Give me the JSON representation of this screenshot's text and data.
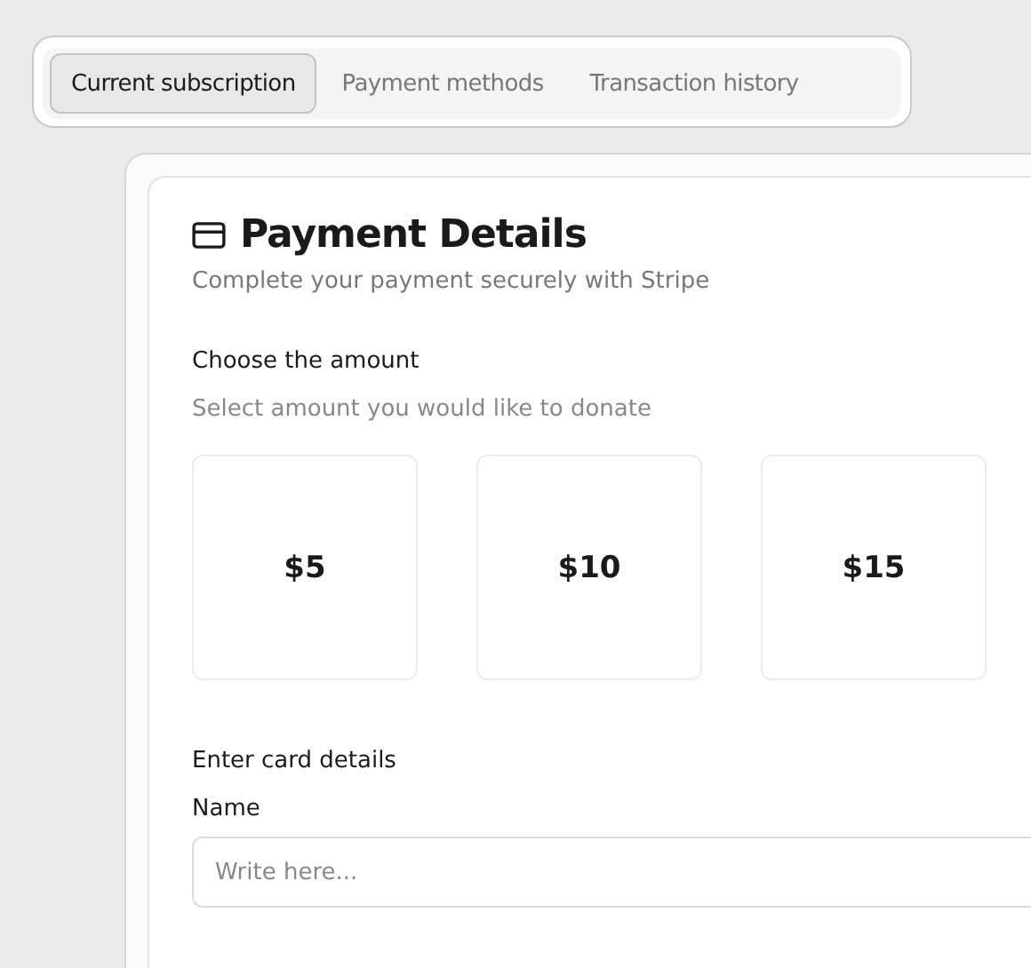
{
  "tabs": [
    {
      "label": "Current subscription",
      "selected": true
    },
    {
      "label": "Payment methods",
      "selected": false
    },
    {
      "label": "Transaction history",
      "selected": false
    }
  ],
  "card": {
    "title": "Payment Details",
    "subtitle": "Complete your payment securely with Stripe",
    "amount_heading": "Choose the amount",
    "amount_hint": "Select amount you would like to donate",
    "amounts": [
      "$5",
      "$10",
      "$15"
    ],
    "card_heading": "Enter card details",
    "name_label": "Name",
    "name_placeholder": "Write here..."
  }
}
